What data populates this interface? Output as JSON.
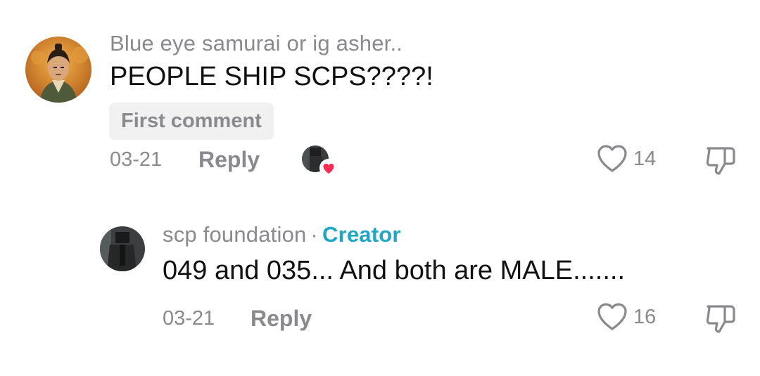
{
  "comments": [
    {
      "username": "Blue eye samurai or ig asher..",
      "text": "PEOPLE SHIP SCPS????!",
      "badge": "First comment",
      "date": "03-21",
      "reply_label": "Reply",
      "likes": "14",
      "avatar_icon": "samurai-avatar",
      "liked_by_creator": true
    },
    {
      "username": "scp foundation",
      "separator": "·",
      "role": "Creator",
      "text": "049 and 035... And both are MALE.......",
      "date": "03-21",
      "reply_label": "Reply",
      "likes": "16",
      "avatar_icon": "dark-figure-avatar"
    }
  ],
  "colors": {
    "muted": "#8a8a8e",
    "text": "#111111",
    "creator": "#1ea7c4",
    "heart_badge": "#fe2c55"
  }
}
